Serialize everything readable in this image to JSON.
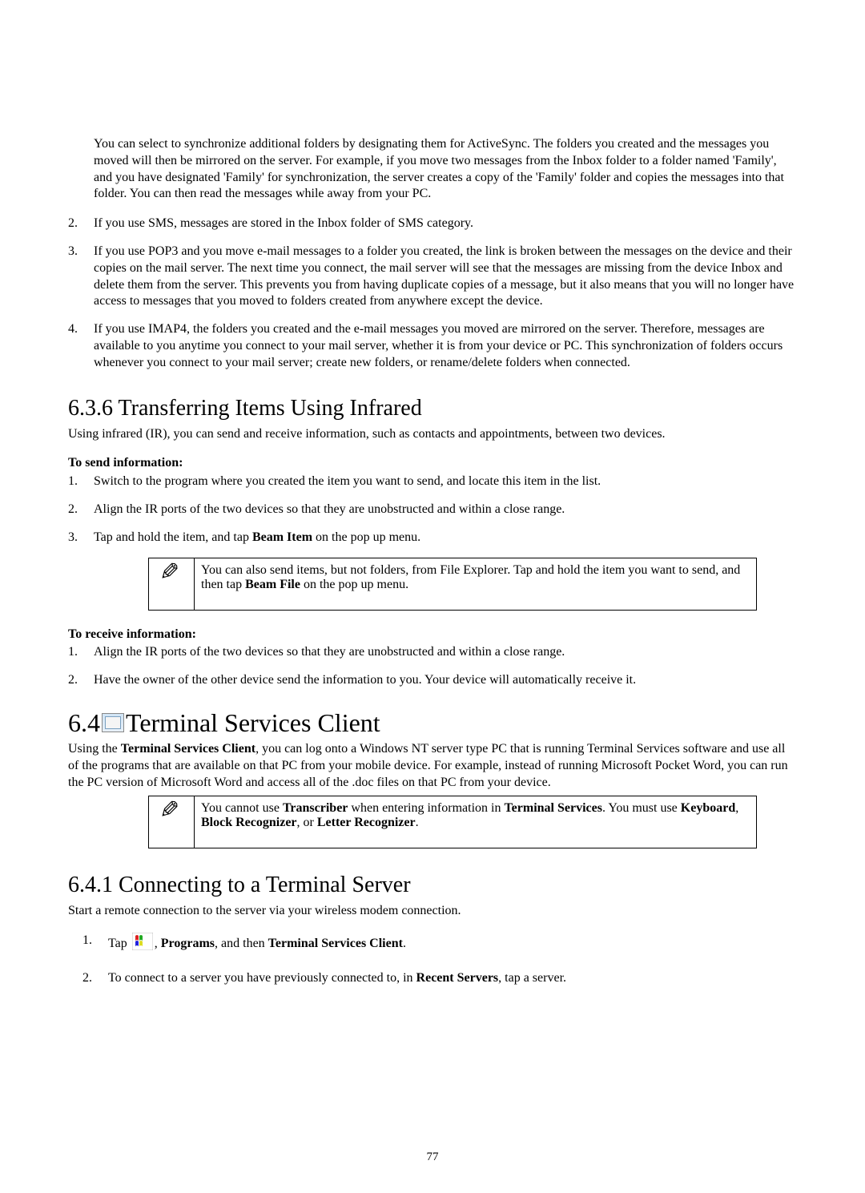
{
  "intro_paragraph": "You can select to synchronize additional folders by designating them for ActiveSync. The folders you created and the messages you moved will then be mirrored on the server. For example, if you move two messages from the Inbox folder to a folder named 'Family', and you have designated 'Family' for synchronization, the server creates a copy of the 'Family' folder and copies the messages into that folder. You can then read the messages while away from your PC.",
  "list1": {
    "2": "If you use SMS, messages are stored in the Inbox folder of SMS category.",
    "3": "If you use POP3 and you move e-mail messages to a folder you created, the link is broken between the messages on the device and their copies on the mail server. The next time you connect, the mail server will see that the messages are missing from the device Inbox and delete them from the server. This prevents you from having duplicate copies of a message, but it also means that you will no longer have access to messages that you moved to folders created from anywhere except the device.",
    "4": "If you use IMAP4, the folders you created and the e-mail messages you moved are mirrored on the server. Therefore, messages are available to you anytime you connect to your mail server, whether it is from your device or PC. This synchronization of folders occurs whenever you connect to your mail server; create new folders, or rename/delete folders when connected."
  },
  "section_636": {
    "title": "6.3.6 Transferring Items Using Infrared",
    "intro": "Using infrared (IR), you can send and receive information, such as contacts and appointments, between two devices.",
    "send_heading": "To send information:",
    "send_steps": {
      "1": "Switch to the program where you created the item you want to send, and locate this item in the list.",
      "2": "Align the IR ports of the two devices so that they are unobstructed and within a close range.",
      "3_pre": "Tap and hold the item, and tap ",
      "3_bold": "Beam Item",
      "3_post": " on the pop up menu."
    },
    "note_pre": "You can also send items, but not folders, from File Explorer. Tap and hold the item you want to send, and then tap ",
    "note_bold": "Beam File",
    "note_post": " on the pop up menu.",
    "recv_heading": "To receive information:",
    "recv_steps": {
      "1": "Align the IR ports of the two devices so that they are unobstructed and within a close range.",
      "2": "Have the owner of the other device send the information to you. Your device will automatically receive it."
    }
  },
  "section_64": {
    "number": "6.4 ",
    "title": " Terminal Services Client",
    "intro_a": "Using the ",
    "intro_bold": "Terminal Services Client",
    "intro_b": ", you can log onto a Windows NT server type PC that is running Terminal Services software and use all of the programs that are available on that PC from your mobile device. For example, instead of running Microsoft Pocket Word, you can run the PC version of Microsoft Word and access all of the .doc files on that PC from your device.",
    "note_parts": {
      "a": "You cannot use ",
      "b": "Transcriber",
      "c": " when entering information in ",
      "d": "Terminal Services",
      "e": ". You must use ",
      "f": "Keyboard",
      "g": ", ",
      "h": "Block Recognizer",
      "i": ", or ",
      "j": "Letter Recognizer",
      "k": "."
    }
  },
  "section_641": {
    "title": "6.4.1 Connecting to a Terminal Server",
    "intro": "Start a remote connection to the server via your wireless modem connection.",
    "steps": {
      "1_pre": "Tap ",
      "1_mid": ", ",
      "1_b1": "Programs",
      "1_mid2": ", and then ",
      "1_b2": "Terminal Services Client",
      "1_post": ".",
      "2_pre": "To connect to a server you have previously connected to, in ",
      "2_b": "Recent Servers",
      "2_post": ", tap a server."
    }
  },
  "page_number": "77"
}
